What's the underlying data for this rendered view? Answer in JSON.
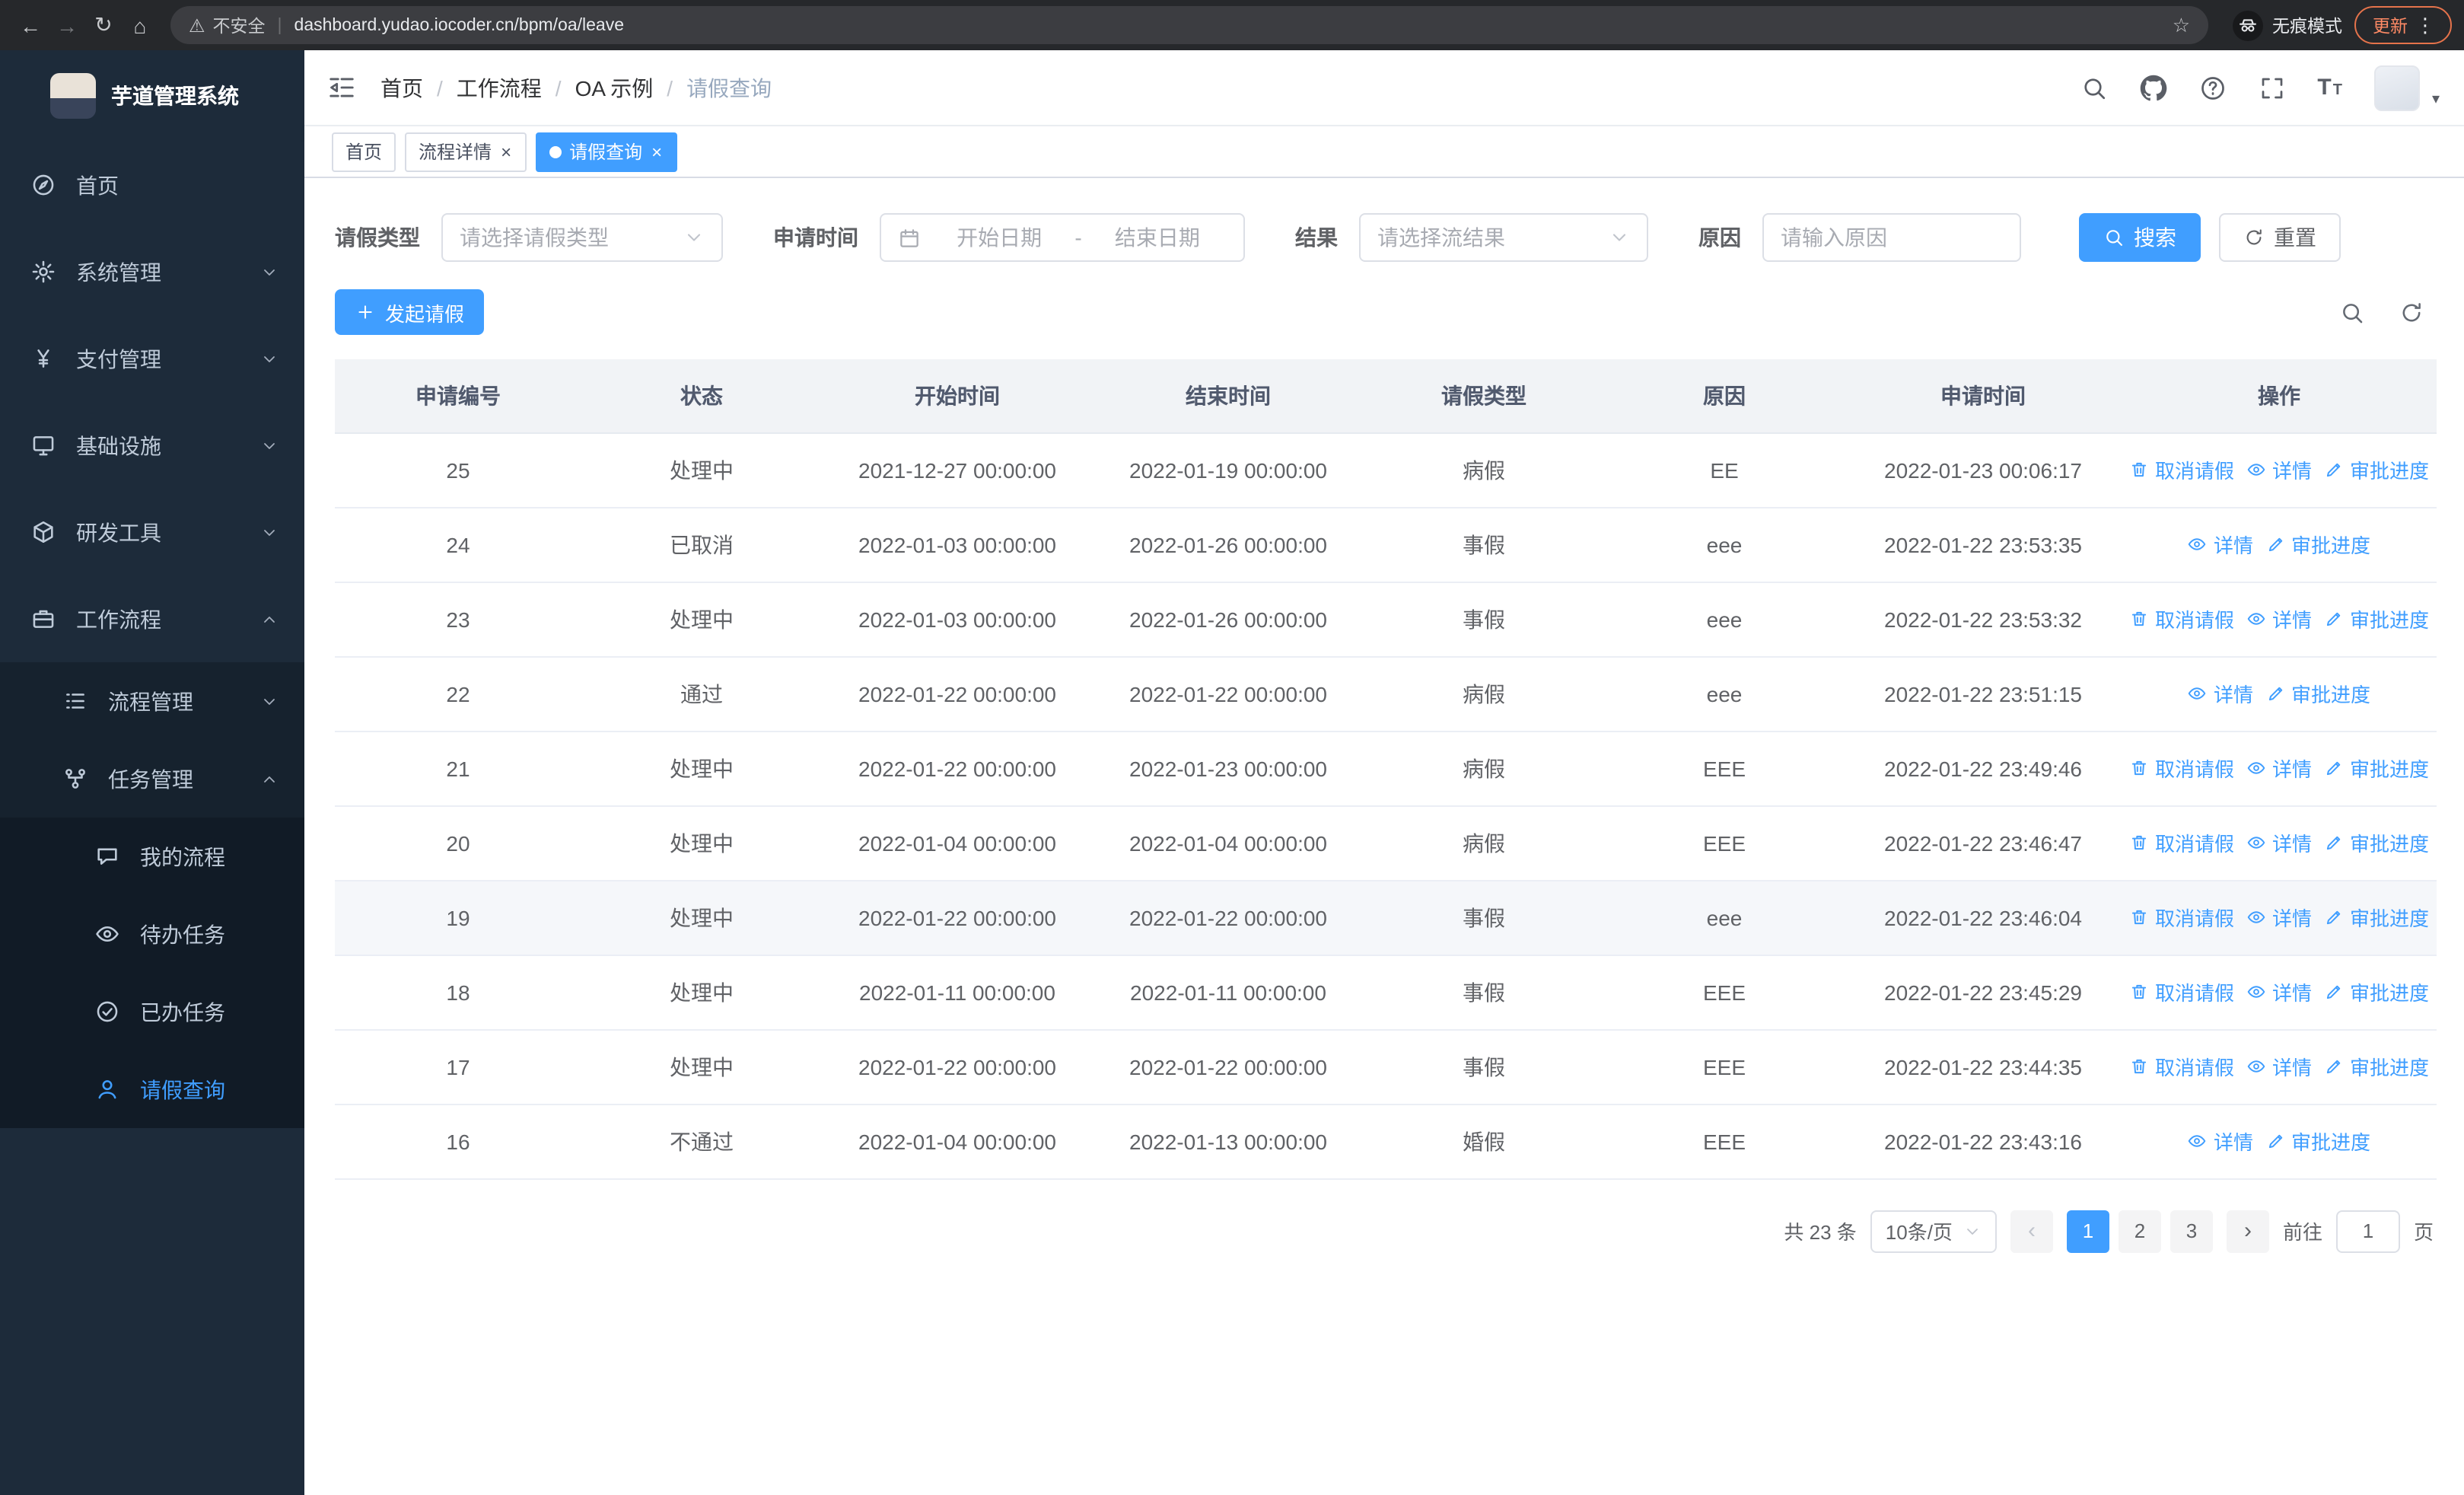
{
  "theme": {
    "accent": "#409eff",
    "sidebar_bg": "#1d2b3a",
    "sidebar_submenu_bg": "#16222e",
    "sidebar_text": "#bfcbd9",
    "table_header_bg": "#f1f3f6",
    "link_color": "#409eff"
  },
  "browser": {
    "security_warning": "不安全",
    "url": "dashboard.yudao.iocoder.cn/bpm/oa/leave",
    "incognito_label": "无痕模式",
    "update_label": "更新",
    "icons": {
      "back": "←",
      "forward": "→",
      "reload": "↻",
      "home": "⌂",
      "warning": "⚠",
      "divider": "|",
      "star": "☆",
      "dots": "⋮"
    }
  },
  "app": {
    "title": "芋道管理系统",
    "breadcrumb": [
      "首页",
      "工作流程",
      "OA 示例",
      "请假查询"
    ],
    "breadcrumb_separator": "/",
    "icons": {
      "caret": "▾",
      "fontsize_big": "T",
      "fontsize_small": "T",
      "tab_close": "×"
    },
    "tabs": [
      {
        "key": "home",
        "label": "首页",
        "closable": false,
        "active": false
      },
      {
        "key": "process-detail",
        "label": "流程详情",
        "closable": true,
        "active": false
      },
      {
        "key": "leave-query",
        "label": "请假查询",
        "closable": true,
        "active": true
      }
    ]
  },
  "sidebar": {
    "items": [
      {
        "key": "home",
        "label": "首页",
        "icon": "dashboard",
        "depth": 0
      },
      {
        "key": "system",
        "label": "系统管理",
        "icon": "gear",
        "depth": 0,
        "chevron": "down"
      },
      {
        "key": "payment",
        "label": "支付管理",
        "icon": "yen",
        "depth": 0,
        "chevron": "down"
      },
      {
        "key": "infra",
        "label": "基础设施",
        "icon": "monitor",
        "depth": 0,
        "chevron": "down"
      },
      {
        "key": "devtools",
        "label": "研发工具",
        "icon": "cube",
        "depth": 0,
        "chevron": "down"
      },
      {
        "key": "workflow",
        "label": "工作流程",
        "icon": "briefcase",
        "depth": 0,
        "chevron": "up"
      },
      {
        "key": "process-mgmt",
        "label": "流程管理",
        "icon": "list",
        "depth": 1,
        "chevron": "down"
      },
      {
        "key": "task-mgmt",
        "label": "任务管理",
        "icon": "flow",
        "depth": 1,
        "chevron": "up"
      },
      {
        "key": "my-process",
        "label": "我的流程",
        "icon": "chat",
        "depth": 2
      },
      {
        "key": "todo-tasks",
        "label": "待办任务",
        "icon": "eye",
        "depth": 2
      },
      {
        "key": "done-tasks",
        "label": "已办任务",
        "icon": "check-circle",
        "depth": 2
      },
      {
        "key": "leave-query",
        "label": "请假查询",
        "icon": "user",
        "depth": 2,
        "active": true
      }
    ]
  },
  "filters": {
    "leave_type_label": "请假类型",
    "leave_type_placeholder": "请选择请假类型",
    "apply_time_label": "申请时间",
    "start_date_placeholder": "开始日期",
    "range_separator": "-",
    "end_date_placeholder": "结束日期",
    "result_label": "结果",
    "result_placeholder": "请选择流结果",
    "reason_label": "原因",
    "reason_placeholder": "请输入原因",
    "search_label": "搜索",
    "reset_label": "重置"
  },
  "toolbar": {
    "create_label": "发起请假"
  },
  "table": {
    "headers": [
      "申请编号",
      "状态",
      "开始时间",
      "结束时间",
      "请假类型",
      "原因",
      "申请时间",
      "操作"
    ],
    "action_labels": {
      "cancel": "取消请假",
      "detail": "详情",
      "progress": "审批进度"
    },
    "rows": [
      {
        "id": "25",
        "status": "处理中",
        "start": "2021-12-27 00:00:00",
        "end": "2022-01-19 00:00:00",
        "type": "病假",
        "reason": "EE",
        "applied": "2022-01-23 00:06:17",
        "actions": [
          "cancel",
          "detail",
          "progress"
        ]
      },
      {
        "id": "24",
        "status": "已取消",
        "start": "2022-01-03 00:00:00",
        "end": "2022-01-26 00:00:00",
        "type": "事假",
        "reason": "eee",
        "applied": "2022-01-22 23:53:35",
        "actions": [
          "detail",
          "progress"
        ]
      },
      {
        "id": "23",
        "status": "处理中",
        "start": "2022-01-03 00:00:00",
        "end": "2022-01-26 00:00:00",
        "type": "事假",
        "reason": "eee",
        "applied": "2022-01-22 23:53:32",
        "actions": [
          "cancel",
          "detail",
          "progress"
        ]
      },
      {
        "id": "22",
        "status": "通过",
        "start": "2022-01-22 00:00:00",
        "end": "2022-01-22 00:00:00",
        "type": "病假",
        "reason": "eee",
        "applied": "2022-01-22 23:51:15",
        "actions": [
          "detail",
          "progress"
        ]
      },
      {
        "id": "21",
        "status": "处理中",
        "start": "2022-01-22 00:00:00",
        "end": "2022-01-23 00:00:00",
        "type": "病假",
        "reason": "EEE",
        "applied": "2022-01-22 23:49:46",
        "actions": [
          "cancel",
          "detail",
          "progress"
        ]
      },
      {
        "id": "20",
        "status": "处理中",
        "start": "2022-01-04 00:00:00",
        "end": "2022-01-04 00:00:00",
        "type": "病假",
        "reason": "EEE",
        "applied": "2022-01-22 23:46:47",
        "actions": [
          "cancel",
          "detail",
          "progress"
        ]
      },
      {
        "id": "19",
        "status": "处理中",
        "start": "2022-01-22 00:00:00",
        "end": "2022-01-22 00:00:00",
        "type": "事假",
        "reason": "eee",
        "applied": "2022-01-22 23:46:04",
        "actions": [
          "cancel",
          "detail",
          "progress"
        ],
        "highlighted": true
      },
      {
        "id": "18",
        "status": "处理中",
        "start": "2022-01-11 00:00:00",
        "end": "2022-01-11 00:00:00",
        "type": "事假",
        "reason": "EEE",
        "applied": "2022-01-22 23:45:29",
        "actions": [
          "cancel",
          "detail",
          "progress"
        ]
      },
      {
        "id": "17",
        "status": "处理中",
        "start": "2022-01-22 00:00:00",
        "end": "2022-01-22 00:00:00",
        "type": "事假",
        "reason": "EEE",
        "applied": "2022-01-22 23:44:35",
        "actions": [
          "cancel",
          "detail",
          "progress"
        ]
      },
      {
        "id": "16",
        "status": "不通过",
        "start": "2022-01-04 00:00:00",
        "end": "2022-01-13 00:00:00",
        "type": "婚假",
        "reason": "EEE",
        "applied": "2022-01-22 23:43:16",
        "actions": [
          "detail",
          "progress"
        ]
      }
    ]
  },
  "pagination": {
    "total_text": "共 23 条",
    "page_size": "10条/页",
    "prev_icon": "‹",
    "next_icon": "›",
    "pages": [
      "1",
      "2",
      "3"
    ],
    "active_page": "1",
    "goto_label": "前往",
    "goto_value": "1",
    "page_unit": "页"
  }
}
